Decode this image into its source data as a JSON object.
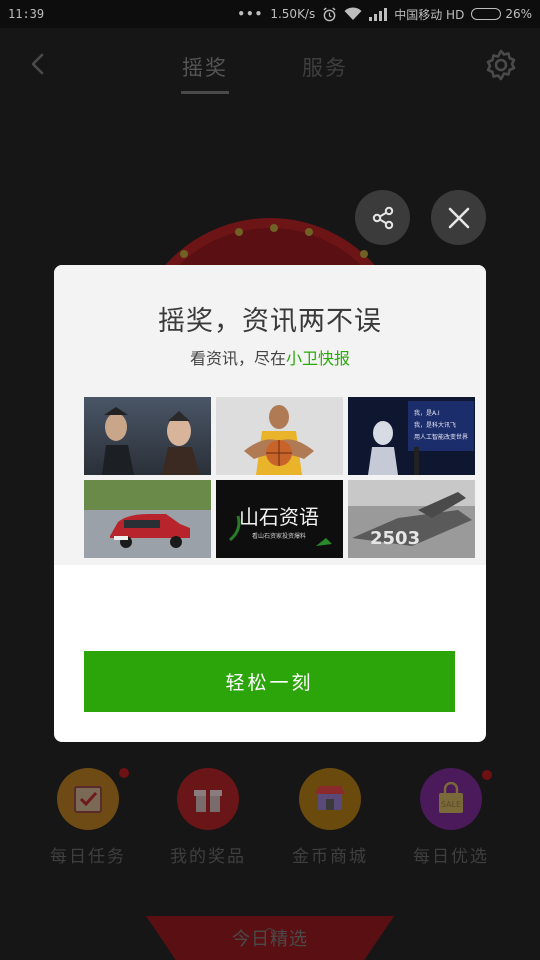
{
  "status": {
    "time": "11:39",
    "speed": "1.50K/s",
    "carrier": "中国移动 HD",
    "battery": "26%",
    "battery_level": 0.26
  },
  "header": {
    "tabs": [
      "摇奖",
      "服务"
    ]
  },
  "modal": {
    "title": "摇奖，资讯两不误",
    "subtitle_prefix": "看资讯，尽在",
    "subtitle_brand": "小卫快报",
    "thumb_texts": {
      "robot_slide": [
        "我，是A.I",
        "我，是科大讯飞",
        "用人工智能改变世界"
      ],
      "ink_title": "山石资语",
      "ink_sub": "看山石资家投资爆料",
      "plane_number": "2503"
    },
    "cta_label": "轻松一刻",
    "brand_color": "#2aaa0a"
  },
  "shortcuts": [
    {
      "label": "每日任务",
      "icon": "checklist-icon",
      "color": "#6e4a15",
      "badge": true
    },
    {
      "label": "我的奖品",
      "icon": "gift-icon",
      "color": "#6a1517",
      "badge": false
    },
    {
      "label": "金币商城",
      "icon": "store-icon",
      "color": "#6b4a0e",
      "badge": false
    },
    {
      "label": "每日优选",
      "icon": "sale-bag-icon",
      "color": "#4a1a5a",
      "badge": true
    }
  ],
  "bottom_tab": "今日精选"
}
